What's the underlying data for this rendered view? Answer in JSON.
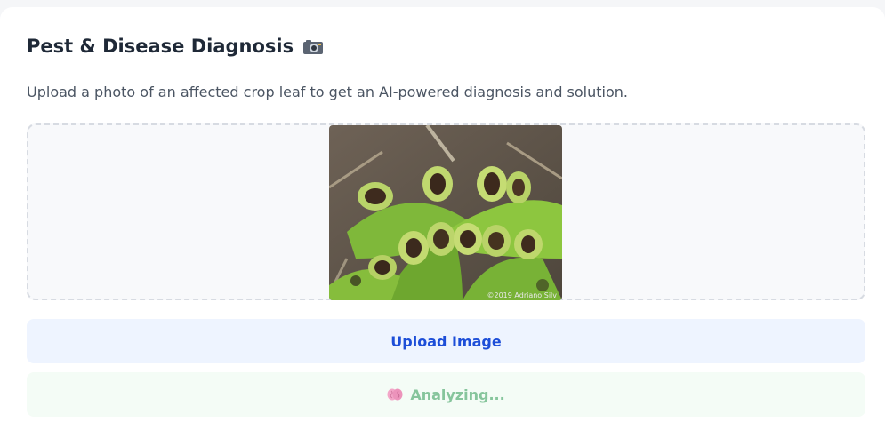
{
  "panel": {
    "title": "Pest & Disease Diagnosis",
    "title_icon": "camera-icon",
    "subtitle": "Upload a photo of an affected crop leaf to get an AI-powered diagnosis and solution."
  },
  "image_preview": {
    "watermark": "©2019 Adriano Silv"
  },
  "actions": {
    "upload_label": "Upload Image",
    "analyze_label": "Analyzing...",
    "analyze_icon": "brain-icon"
  },
  "colors": {
    "upload_bg": "#eef4ff",
    "upload_text": "#1d4ed8",
    "analyze_bg": "#f4fcf6",
    "analyze_text": "#86c59c"
  }
}
